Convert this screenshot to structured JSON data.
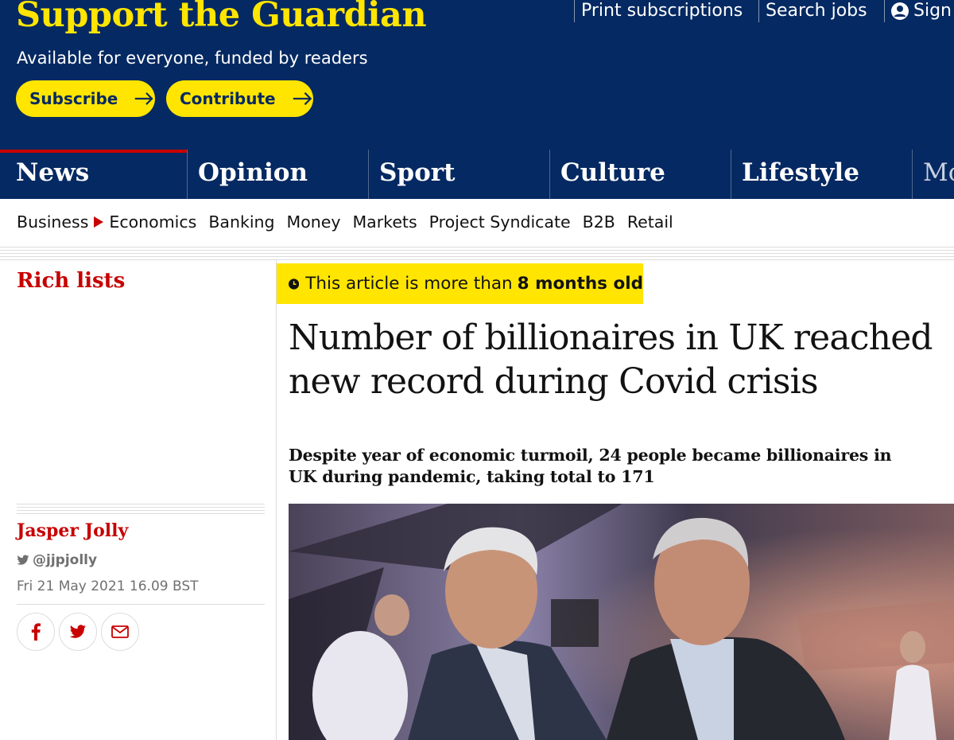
{
  "header": {
    "support_title": "Support the Guardian",
    "support_subtitle": "Available for everyone, funded by readers",
    "subscribe_label": "Subscribe",
    "contribute_label": "Contribute",
    "print_subscriptions": "Print subscriptions",
    "search_jobs": "Search jobs",
    "sign_in": "Sign"
  },
  "nav": {
    "items": [
      "News",
      "Opinion",
      "Sport",
      "Culture",
      "Lifestyle",
      "Mo"
    ],
    "active": "News"
  },
  "subnav": {
    "items": [
      "Business",
      "Economics",
      "Banking",
      "Money",
      "Markets",
      "Project Syndicate",
      "B2B",
      "Retail"
    ]
  },
  "article": {
    "section": "Rich lists",
    "age_notice_prefix": "This article is more than",
    "age_notice_bold": "8 months old",
    "headline": "Number of billionaires in UK reached new record during Covid crisis",
    "standfirst": "Despite year of economic turmoil, 24 people became billionaires in UK during pandemic, taking total to 171",
    "author": "Jasper Jolly",
    "author_twitter": "@jjpjolly",
    "published": "Fri 21 May 2021 16.09 BST"
  },
  "share": {
    "icons": [
      "facebook-icon",
      "twitter-icon",
      "email-icon"
    ]
  },
  "colors": {
    "brand_navy": "#052962",
    "brand_yellow": "#ffe500",
    "news_red": "#c70000"
  }
}
